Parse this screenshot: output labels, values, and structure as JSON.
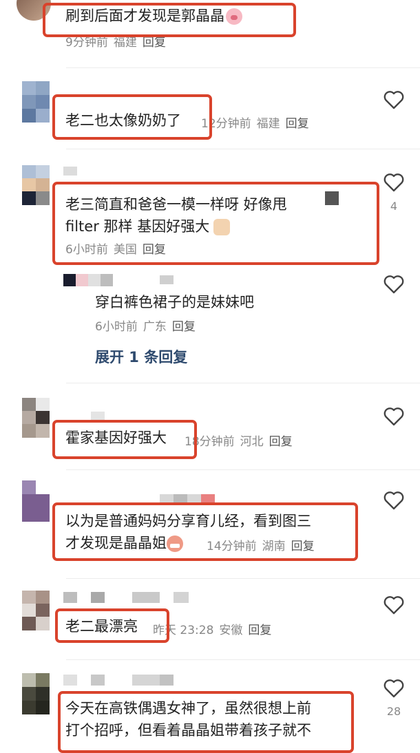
{
  "comments": [
    {
      "text": "刷到后面才发现是郭晶晶",
      "time": "9分钟前",
      "location": "福建",
      "reply": "回复"
    },
    {
      "text": "老二也太像奶奶了",
      "time": "12分钟前",
      "location": "福建",
      "reply": "回复"
    },
    {
      "text_line1": "老三简直和爸爸一模一样呀 好像甩",
      "text_line2": "filter 那样 基因好强大",
      "time": "6小时前",
      "location": "美国",
      "reply": "回复",
      "likes": "4"
    },
    {
      "text": "穿白裤色裙子的是妹妹吧",
      "time": "6小时前",
      "location": "广东",
      "reply": "回复",
      "expand": "展开 1 条回复"
    },
    {
      "text": "霍家基因好强大",
      "time": "18分钟前",
      "location": "河北",
      "reply": "回复"
    },
    {
      "text_line1": "以为是普通妈妈分享育儿经，看到图三",
      "text_line2": "才发现是晶晶姐",
      "time": "14分钟前",
      "location": "湖南",
      "reply": "回复"
    },
    {
      "text": "老二最漂亮",
      "time": "昨天 23:28",
      "location": "安徽",
      "reply": "回复"
    },
    {
      "text_line1": "今天在高铁偶遇女神了，虽然很想上前",
      "text_line2": "打个招呼，但看着晶晶姐带着孩子就不",
      "likes": "28"
    }
  ],
  "colors": {
    "highlight": "#d9432c",
    "meta": "#888888",
    "link": "#2e4a6e",
    "heart": "#444444"
  },
  "icons": {
    "like": "heart-outline-icon",
    "emoji_pig": "pig-face-emoji",
    "emoji_thumb": "thumbs-up-emoji",
    "emoji_grin": "grinning-face-emoji"
  }
}
